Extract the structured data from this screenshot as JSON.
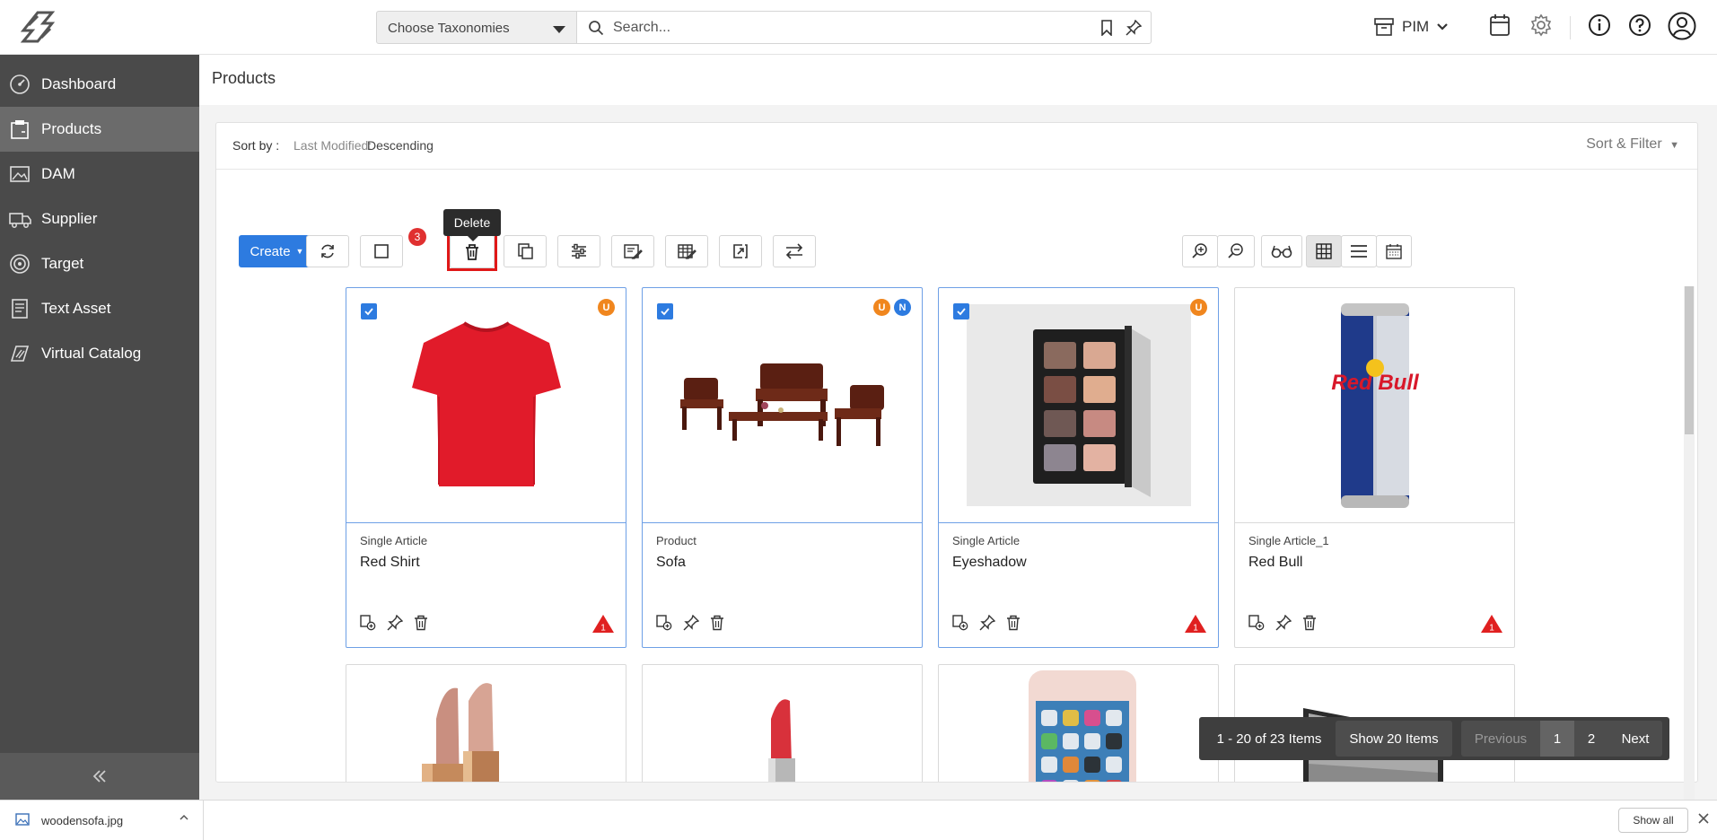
{
  "topbar": {
    "taxonomy_label": "Choose Taxonomies",
    "search_placeholder": "Search...",
    "module_label": "PIM"
  },
  "sidebar": {
    "items": [
      {
        "label": "Dashboard",
        "icon": "dashboard-icon"
      },
      {
        "label": "Products",
        "icon": "products-icon"
      },
      {
        "label": "DAM",
        "icon": "image-icon"
      },
      {
        "label": "Supplier",
        "icon": "truck-icon"
      },
      {
        "label": "Target",
        "icon": "target-icon"
      },
      {
        "label": "Text Asset",
        "icon": "document-icon"
      },
      {
        "label": "Virtual Catalog",
        "icon": "catalog-icon"
      }
    ],
    "active": "Products"
  },
  "page": {
    "title": "Products"
  },
  "sort": {
    "label": "Sort by :",
    "field": "Last Modified:",
    "value": "Descending",
    "filter_label": "Sort & Filter"
  },
  "toolbar": {
    "create_label": "Create",
    "selected_count": "3",
    "tooltip": "Delete"
  },
  "cards": [
    {
      "type": "Single Article",
      "name": "Red Shirt",
      "selected": true,
      "flags": [
        "U"
      ],
      "warning": "1"
    },
    {
      "type": "Product",
      "name": "Sofa",
      "selected": true,
      "flags": [
        "U",
        "N"
      ],
      "warning": ""
    },
    {
      "type": "Single Article",
      "name": "Eyeshadow",
      "selected": true,
      "flags": [
        "U"
      ],
      "warning": "1"
    },
    {
      "type": "Single Article_1",
      "name": "Red Bull",
      "selected": false,
      "flags": [],
      "warning": "1"
    }
  ],
  "pagination": {
    "range": "1 - 20 of 23 Items",
    "show": "Show 20 Items",
    "previous": "Previous",
    "pages": [
      "1",
      "2"
    ],
    "next": "Next"
  },
  "download": {
    "filename": "woodensofa.jpg",
    "show_all": "Show all"
  },
  "colors": {
    "accent": "#2d7be0",
    "sidebar": "#4a4a4a",
    "flag_u": "#f0861e",
    "flag_n": "#2d7be0",
    "warning": "#e02020"
  }
}
